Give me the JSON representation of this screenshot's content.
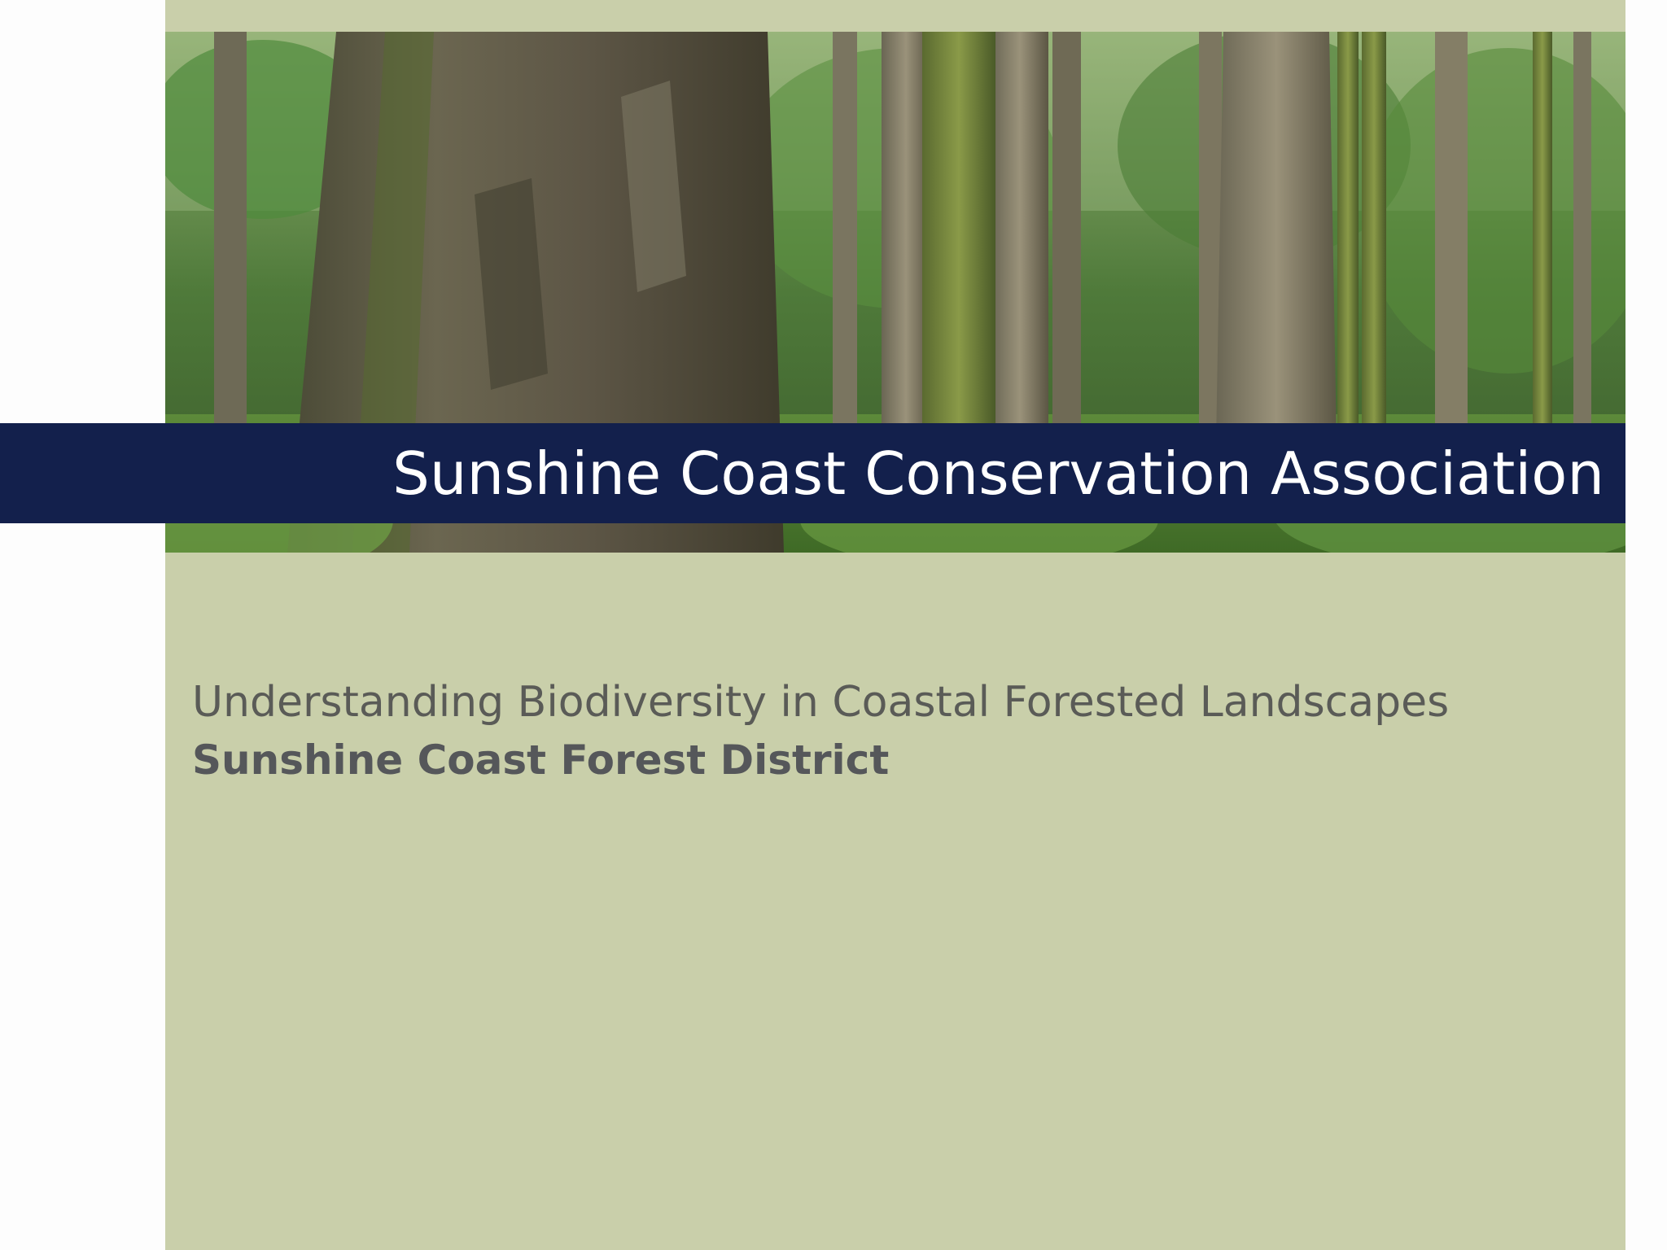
{
  "slide": {
    "title": "Sunshine Coast Conservation Association",
    "subtitle_line1": "Understanding Biodiversity in Coastal Forested Landscapes",
    "subtitle_line2": "Sunshine Coast Forest District"
  },
  "colors": {
    "panel": "#c9cfaa",
    "title_band": "#13204c",
    "title_text": "#ffffff",
    "subtitle_text": "#5a5b57"
  },
  "image": {
    "subject": "old-growth-forest-photo"
  }
}
